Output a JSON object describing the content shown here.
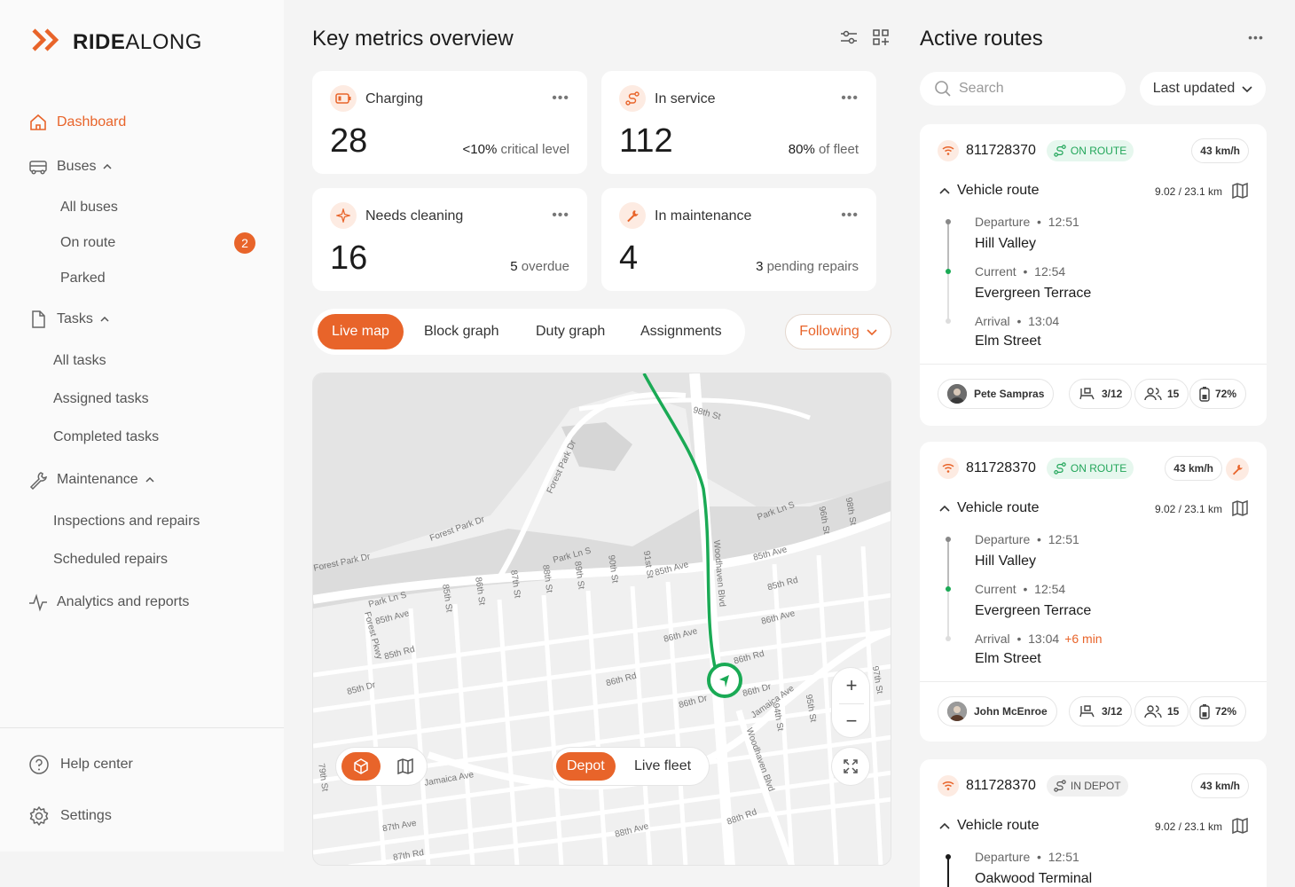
{
  "brand": {
    "bold": "RIDE",
    "light": "ALONG",
    "accent": "#e8642a"
  },
  "sidebar": {
    "dashboard": "Dashboard",
    "buses": {
      "label": "Buses",
      "items": [
        "All buses",
        "On route",
        "Parked"
      ],
      "on_route_badge": "2"
    },
    "tasks": {
      "label": "Tasks",
      "items": [
        "All tasks",
        "Assigned tasks",
        "Completed tasks"
      ]
    },
    "maintenance": {
      "label": "Maintenance",
      "items": [
        "Inspections and repairs",
        "Scheduled repairs"
      ]
    },
    "analytics": "Analytics and reports",
    "help": "Help center",
    "settings": "Settings"
  },
  "metrics": {
    "title": "Key metrics overview",
    "cards": [
      {
        "label": "Charging",
        "value": "28",
        "note_strong": "<10%",
        "note": "critical level",
        "icon": "battery-icon"
      },
      {
        "label": "In service",
        "value": "112",
        "note_strong": "80%",
        "note": "of fleet",
        "icon": "route-icon"
      },
      {
        "label": "Needs cleaning",
        "value": "16",
        "note_strong": "5",
        "note": "overdue",
        "icon": "sparkle-icon"
      },
      {
        "label": "In maintenance",
        "value": "4",
        "note_strong": "3",
        "note": "pending repairs",
        "icon": "wrench-icon"
      }
    ]
  },
  "tabs": [
    "Live map",
    "Block graph",
    "Duty graph",
    "Assignments"
  ],
  "following": "Following",
  "map": {
    "mode_toggle": [
      "Depot",
      "Live fleet"
    ],
    "streets": [
      "98th St",
      "Forest Park Dr",
      "Forest Park Dr",
      "Forest Park Dr",
      "Park Ln S",
      "Park Ln S",
      "Park Ln S",
      "85th Ave",
      "85th Ave",
      "85th Ave",
      "85th Rd",
      "85th Rd",
      "86th Ave",
      "86th Ave",
      "86th Rd",
      "86th Rd",
      "86th Dr",
      "86th Dr",
      "85th Dr",
      "Woodhaven Blvd",
      "Woodhaven Blvd",
      "Jamaica Ave",
      "Jamaica Ave",
      "87th Ave",
      "87th Rd",
      "88th Ave",
      "88th Rd",
      "96th St",
      "98th St",
      "91st St",
      "90th St",
      "89th St",
      "88th St",
      "87th St",
      "86th St",
      "85th St",
      "94th St",
      "95th St",
      "97th St",
      "79th St",
      "Forest Pkwy"
    ]
  },
  "active_routes": {
    "title": "Active routes",
    "search_placeholder": "Search",
    "sort": "Last updated",
    "cards": [
      {
        "id": "811728370",
        "status": "ON ROUTE",
        "speed": "43 km/h",
        "route_title": "Vehicle route",
        "distance": "9.02 / 23.1 km",
        "stops": [
          {
            "label": "Departure",
            "time": "12:51",
            "name": "Hill Valley"
          },
          {
            "label": "Current",
            "time": "12:54",
            "name": "Evergreen Terrace"
          },
          {
            "label": "Arrival",
            "time": "13:04",
            "name": "Elm Street",
            "delay": ""
          }
        ],
        "driver": "Pete Sampras",
        "seats": "3/12",
        "passengers": "15",
        "battery": "72%"
      },
      {
        "id": "811728370",
        "status": "ON ROUTE",
        "speed": "43 km/h",
        "route_title": "Vehicle route",
        "distance": "9.02 / 23.1 km",
        "stops": [
          {
            "label": "Departure",
            "time": "12:51",
            "name": "Hill Valley"
          },
          {
            "label": "Current",
            "time": "12:54",
            "name": "Evergreen Terrace"
          },
          {
            "label": "Arrival",
            "time": "13:04",
            "name": "Elm Street",
            "delay": "+6 min"
          }
        ],
        "driver": "John McEnroe",
        "seats": "3/12",
        "passengers": "15",
        "battery": "72%"
      },
      {
        "id": "811728370",
        "status": "IN DEPOT",
        "speed": "43 km/h",
        "route_title": "Vehicle route",
        "distance": "9.02 / 23.1 km",
        "stops": [
          {
            "label": "Departure",
            "time": "12:51",
            "name": "Oakwood Terminal"
          }
        ]
      }
    ]
  }
}
